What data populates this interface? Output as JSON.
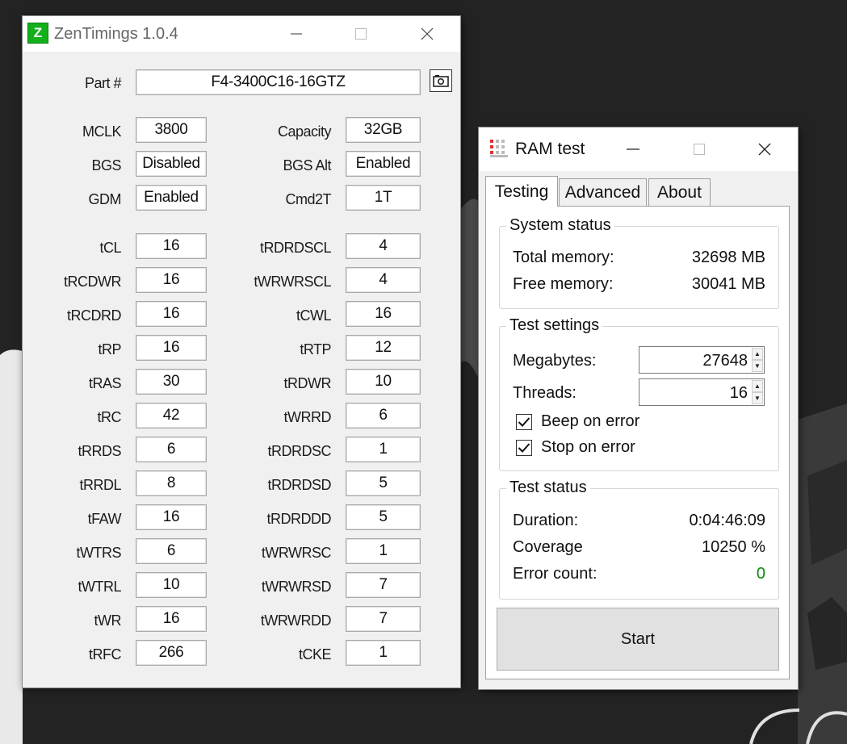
{
  "zentimings": {
    "title": "ZenTimings 1.0.4",
    "logo_letter": "Z",
    "part_label": "Part #",
    "part_value": "F4-3400C16-16GTZ",
    "left_fields": [
      {
        "label": "MCLK",
        "value": "3800"
      },
      {
        "label": "BGS",
        "value": "Disabled"
      },
      {
        "label": "GDM",
        "value": "Enabled"
      },
      {
        "label": "tCL",
        "value": "16"
      },
      {
        "label": "tRCDWR",
        "value": "16"
      },
      {
        "label": "tRCDRD",
        "value": "16"
      },
      {
        "label": "tRP",
        "value": "16"
      },
      {
        "label": "tRAS",
        "value": "30"
      },
      {
        "label": "tRC",
        "value": "42"
      },
      {
        "label": "tRRDS",
        "value": "6"
      },
      {
        "label": "tRRDL",
        "value": "8"
      },
      {
        "label": "tFAW",
        "value": "16"
      },
      {
        "label": "tWTRS",
        "value": "6"
      },
      {
        "label": "tWTRL",
        "value": "10"
      },
      {
        "label": "tWR",
        "value": "16"
      },
      {
        "label": "tRFC",
        "value": "266"
      }
    ],
    "right_fields": [
      {
        "label": "Capacity",
        "value": "32GB"
      },
      {
        "label": "BGS Alt",
        "value": "Enabled"
      },
      {
        "label": "Cmd2T",
        "value": "1T"
      },
      {
        "label": "tRDRDSCL",
        "value": "4"
      },
      {
        "label": "tWRWRSCL",
        "value": "4"
      },
      {
        "label": "tCWL",
        "value": "16"
      },
      {
        "label": "tRTP",
        "value": "12"
      },
      {
        "label": "tRDWR",
        "value": "10"
      },
      {
        "label": "tWRRD",
        "value": "6"
      },
      {
        "label": "tRDRDSC",
        "value": "1"
      },
      {
        "label": "tRDRDSD",
        "value": "5"
      },
      {
        "label": "tRDRDDD",
        "value": "5"
      },
      {
        "label": "tWRWRSC",
        "value": "1"
      },
      {
        "label": "tWRWRSD",
        "value": "7"
      },
      {
        "label": "tWRWRDD",
        "value": "7"
      },
      {
        "label": "tCKE",
        "value": "1"
      }
    ]
  },
  "ramtest": {
    "title": "RAM test",
    "tabs": [
      "Testing",
      "Advanced",
      "About"
    ],
    "system_status": {
      "title": "System status",
      "total_label": "Total memory:",
      "total_value": "32698 MB",
      "free_label": "Free memory:",
      "free_value": "30041 MB"
    },
    "test_settings": {
      "title": "Test settings",
      "megabytes_label": "Megabytes:",
      "megabytes_value": "27648",
      "threads_label": "Threads:",
      "threads_value": "16",
      "beep_label": "Beep on error",
      "beep_checked": true,
      "stop_label": "Stop on error",
      "stop_checked": true
    },
    "test_status": {
      "title": "Test status",
      "duration_label": "Duration:",
      "duration_value": "0:04:46:09",
      "coverage_label": "Coverage",
      "coverage_value": "10250 %",
      "error_label": "Error count:",
      "error_value": "0",
      "error_color": "#0a8a0a"
    },
    "start_label": "Start"
  },
  "colors": {
    "desktop": "#232323",
    "zt_logo": "#13b01a"
  }
}
